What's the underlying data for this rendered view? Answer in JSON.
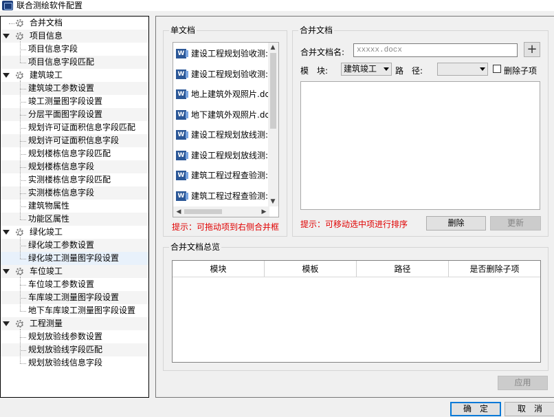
{
  "window": {
    "title": "联合测绘软件配置"
  },
  "tree": {
    "items": [
      {
        "label": "合并文档",
        "level": 0,
        "expandable": false
      },
      {
        "label": "项目信息",
        "level": 0,
        "expandable": true
      },
      {
        "label": "项目信息字段",
        "level": 1
      },
      {
        "label": "项目信息字段匹配",
        "level": 1
      },
      {
        "label": "建筑竣工",
        "level": 0,
        "expandable": true
      },
      {
        "label": "建筑竣工参数设置",
        "level": 1
      },
      {
        "label": "竣工测量图字段设置",
        "level": 1
      },
      {
        "label": "分层平面图字段设置",
        "level": 1
      },
      {
        "label": "规划许可证面积信息字段匹配",
        "level": 1
      },
      {
        "label": "规划许可证面积信息字段",
        "level": 1
      },
      {
        "label": "规划楼栋信息字段匹配",
        "level": 1
      },
      {
        "label": "规划楼栋信息字段",
        "level": 1
      },
      {
        "label": "实测楼栋信息字段匹配",
        "level": 1
      },
      {
        "label": "实测楼栋信息字段",
        "level": 1
      },
      {
        "label": "建筑物属性",
        "level": 1
      },
      {
        "label": "功能区属性",
        "level": 1
      },
      {
        "label": "绿化竣工",
        "level": 0,
        "expandable": true
      },
      {
        "label": "绿化竣工参数设置",
        "level": 1
      },
      {
        "label": "绿化竣工测量图字段设置",
        "level": 1
      },
      {
        "label": "车位竣工",
        "level": 0,
        "expandable": true
      },
      {
        "label": "车位竣工参数设置",
        "level": 1
      },
      {
        "label": "车库竣工测量图字段设置",
        "level": 1
      },
      {
        "label": "地下车库竣工测量图字段设置",
        "level": 1
      },
      {
        "label": "工程测量",
        "level": 0,
        "expandable": true
      },
      {
        "label": "规划放验线参数设置",
        "level": 1
      },
      {
        "label": "规划放验线字段匹配",
        "level": 1
      },
      {
        "label": "规划放验线信息字段",
        "level": 1
      }
    ]
  },
  "single_doc": {
    "title": "单文档",
    "items": [
      "建设工程规划验收测:",
      "建设工程规划验收测:",
      "地上建筑外观照片.dc",
      "地下建筑外观照片.dc",
      "建设工程规划放线测:",
      "建设工程规划放线测:",
      "建筑工程过程查验测:",
      "建筑工程过程查验测:"
    ],
    "icon_text": "W",
    "hint": "提示：可拖动项到右侧合并框"
  },
  "merge_doc": {
    "title": "合并文档",
    "name_label": "合并文档名:",
    "name_placeholder": "xxxxx.docx",
    "add_label": "+",
    "module_label": "模　块:",
    "module_value": "建筑竣工",
    "path_label": "路　径:",
    "path_value": "",
    "delete_sub_label": "删除子项",
    "hint": "提示：可移动选中项进行排序",
    "delete_button": "删除",
    "update_button": "更新"
  },
  "overview": {
    "title": "合并文档总览",
    "columns": [
      "模块",
      "模板",
      "路径",
      "是否删除子项"
    ]
  },
  "buttons": {
    "apply": "应用",
    "ok": "确　定",
    "cancel": "取　消"
  },
  "colors": {
    "hint": "#e00000",
    "selection": "#e8f1fb",
    "accent": "#0078d7"
  }
}
